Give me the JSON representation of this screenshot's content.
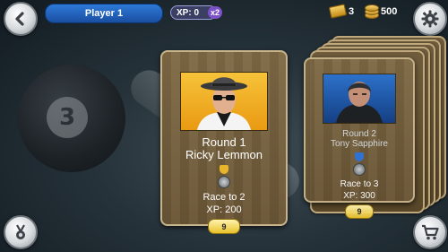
{
  "header": {
    "player_label": "Player 1",
    "xp_text": "XP: 0",
    "xp_multiplier": "x2",
    "tickets": "3",
    "coins": "500"
  },
  "icons": {
    "back": "back-arrow-icon",
    "settings": "gear-icon",
    "achievements": "medal-icon",
    "shop": "cart-icon"
  },
  "background": {
    "ball_number": "3"
  },
  "cards": [
    {
      "round": "Round 1",
      "name": "Ricky Lemmon",
      "race": "Race to 2",
      "xp": "XP: 200",
      "ball": "9",
      "portrait_bg": "#f0ad25",
      "rank_color": "#e8b52a"
    },
    {
      "round": "Round 2",
      "name": "Tony Sapphire",
      "race": "Race to 3",
      "xp": "XP: 300",
      "ball": "9",
      "portrait_bg": "#1f5fb8",
      "rank_color": "#2f74d6"
    }
  ]
}
